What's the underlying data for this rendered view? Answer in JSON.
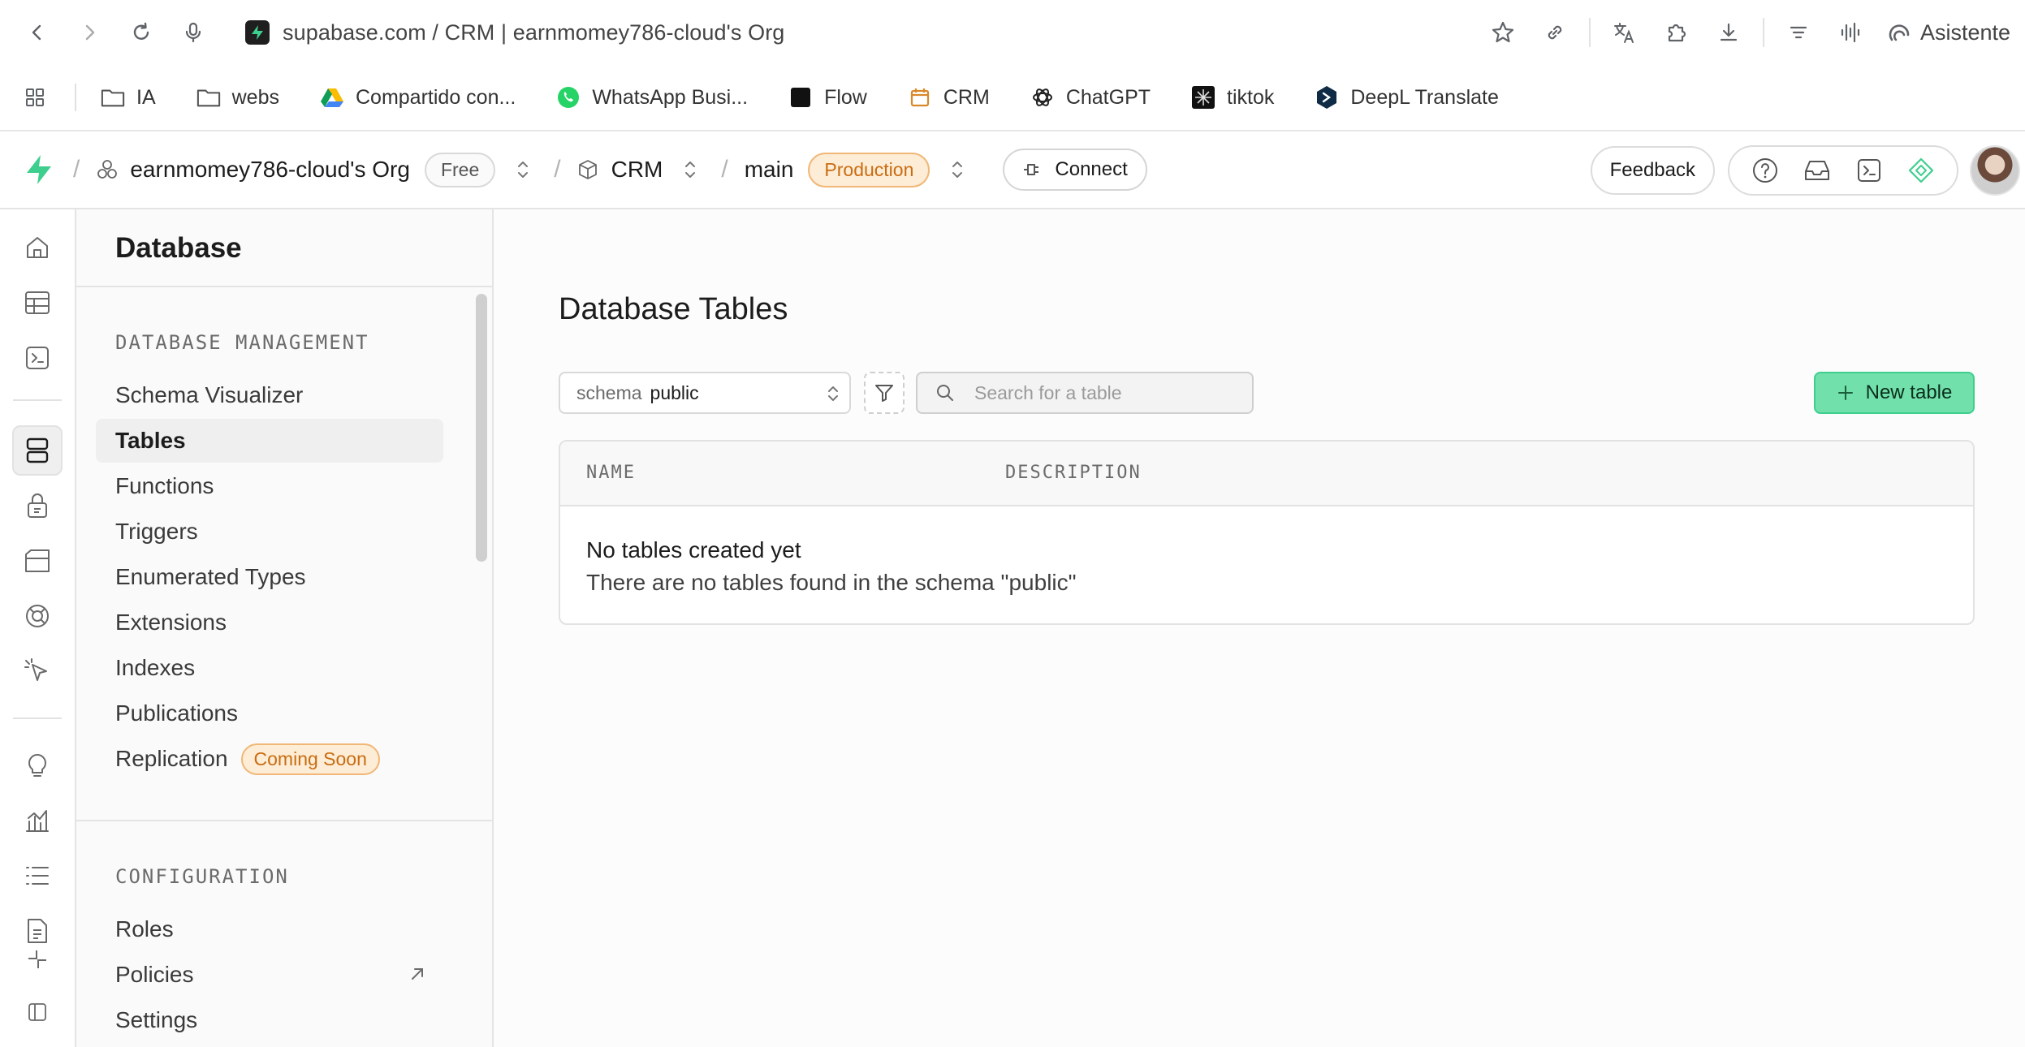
{
  "browser": {
    "url": "supabase.com / CRM | earnmomey786-cloud's Org",
    "assistant_label": "Asistente",
    "bookmarks": [
      {
        "label": "IA",
        "icon": "folder-icon"
      },
      {
        "label": "webs",
        "icon": "folder-icon"
      },
      {
        "label": "Compartido con...",
        "icon": "google-drive-icon"
      },
      {
        "label": "WhatsApp Busi...",
        "icon": "whatsapp-icon"
      },
      {
        "label": "Flow",
        "icon": "flow-icon"
      },
      {
        "label": "CRM",
        "icon": "calendar-icon"
      },
      {
        "label": "ChatGPT",
        "icon": "chatgpt-icon"
      },
      {
        "label": "tiktok",
        "icon": "tiktok-icon"
      },
      {
        "label": "DeepL Translate",
        "icon": "deepl-icon"
      }
    ]
  },
  "topbar": {
    "org_name": "earnmomey786-cloud's Org",
    "plan_badge": "Free",
    "project_name": "CRM",
    "branch_name": "main",
    "env_badge": "Production",
    "connect_label": "Connect",
    "feedback_label": "Feedback"
  },
  "sidebar": {
    "title": "Database",
    "sections": [
      {
        "title": "DATABASE MANAGEMENT",
        "items": [
          {
            "label": "Schema Visualizer"
          },
          {
            "label": "Tables",
            "active": true
          },
          {
            "label": "Functions"
          },
          {
            "label": "Triggers"
          },
          {
            "label": "Enumerated Types"
          },
          {
            "label": "Extensions"
          },
          {
            "label": "Indexes"
          },
          {
            "label": "Publications"
          },
          {
            "label": "Replication",
            "badge": "Coming Soon"
          }
        ]
      },
      {
        "title": "CONFIGURATION",
        "items": [
          {
            "label": "Roles"
          },
          {
            "label": "Policies",
            "external": true
          },
          {
            "label": "Settings"
          }
        ]
      }
    ]
  },
  "main": {
    "title": "Database Tables",
    "schema_label": "schema",
    "schema_value": "public",
    "search_placeholder": "Search for a table",
    "new_table_label": "New table",
    "table": {
      "columns": [
        "NAME",
        "DESCRIPTION"
      ],
      "empty_title": "No tables created yet",
      "empty_description": "There are no tables found in the schema \"public\""
    }
  },
  "colors": {
    "brand_green": "#3ecf8e",
    "button_green": "#72e0ab",
    "warning_orange": "#c86d12"
  }
}
